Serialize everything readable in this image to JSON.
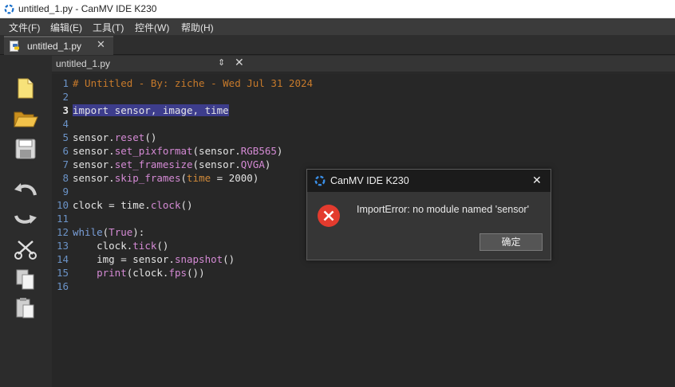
{
  "window": {
    "title": "untitled_1.py - CanMV IDE K230"
  },
  "menubar": {
    "items": [
      {
        "label": "文件(F)"
      },
      {
        "label": "编辑(E)"
      },
      {
        "label": "工具(T)"
      },
      {
        "label": "控件(W)"
      },
      {
        "label": "帮助(H)"
      }
    ]
  },
  "tabs": [
    {
      "label": "untitled_1.py",
      "close_glyph": "✕"
    }
  ],
  "editor": {
    "document_name": "untitled_1.py",
    "switch_glyph": "⇕",
    "close_glyph": "✕",
    "current_line": 3,
    "lines": [
      {
        "num": "1",
        "segs": [
          {
            "t": "# Untitled - By: ziche - Wed Jul 31 2024",
            "c": "#c77a2b"
          }
        ]
      },
      {
        "num": "2",
        "segs": []
      },
      {
        "num": "3",
        "segs": [
          {
            "t": "import sensor, image, time",
            "c": "#e4e4e4",
            "sel": true
          }
        ]
      },
      {
        "num": "4",
        "segs": []
      },
      {
        "num": "5",
        "segs": [
          {
            "t": "sensor.",
            "c": "#e4e4e4"
          },
          {
            "t": "reset",
            "c": "#d48ad4"
          },
          {
            "t": "()",
            "c": "#e4e4e4"
          }
        ]
      },
      {
        "num": "6",
        "segs": [
          {
            "t": "sensor.",
            "c": "#e4e4e4"
          },
          {
            "t": "set_pixformat",
            "c": "#d48ad4"
          },
          {
            "t": "(sensor.",
            "c": "#e4e4e4"
          },
          {
            "t": "RGB565",
            "c": "#d48ad4"
          },
          {
            "t": ")",
            "c": "#e4e4e4"
          }
        ]
      },
      {
        "num": "7",
        "segs": [
          {
            "t": "sensor.",
            "c": "#e4e4e4"
          },
          {
            "t": "set_framesize",
            "c": "#d48ad4"
          },
          {
            "t": "(sensor.",
            "c": "#e4e4e4"
          },
          {
            "t": "QVGA",
            "c": "#d48ad4"
          },
          {
            "t": ")",
            "c": "#e4e4e4"
          }
        ]
      },
      {
        "num": "8",
        "segs": [
          {
            "t": "sensor.",
            "c": "#e4e4e4"
          },
          {
            "t": "skip_frames",
            "c": "#d48ad4"
          },
          {
            "t": "(",
            "c": "#e4e4e4"
          },
          {
            "t": "time",
            "c": "#d08a3a"
          },
          {
            "t": " = ",
            "c": "#e4e4e4"
          },
          {
            "t": "2000",
            "c": "#e4e4e4"
          },
          {
            "t": ")",
            "c": "#e4e4e4"
          }
        ]
      },
      {
        "num": "9",
        "segs": []
      },
      {
        "num": "10",
        "segs": [
          {
            "t": "clock = time.",
            "c": "#e4e4e4"
          },
          {
            "t": "clock",
            "c": "#d48ad4"
          },
          {
            "t": "()",
            "c": "#e4e4e4"
          }
        ]
      },
      {
        "num": "11",
        "segs": []
      },
      {
        "num": "12",
        "segs": [
          {
            "t": "while",
            "c": "#7a9fd9"
          },
          {
            "t": "(",
            "c": "#e4e4e4"
          },
          {
            "t": "True",
            "c": "#d48ad4"
          },
          {
            "t": "):",
            "c": "#e4e4e4"
          }
        ]
      },
      {
        "num": "13",
        "segs": [
          {
            "t": "    clock.",
            "c": "#e4e4e4"
          },
          {
            "t": "tick",
            "c": "#d48ad4"
          },
          {
            "t": "()",
            "c": "#e4e4e4"
          }
        ]
      },
      {
        "num": "14",
        "segs": [
          {
            "t": "    img = sensor.",
            "c": "#e4e4e4"
          },
          {
            "t": "snapshot",
            "c": "#d48ad4"
          },
          {
            "t": "()",
            "c": "#e4e4e4"
          }
        ]
      },
      {
        "num": "15",
        "segs": [
          {
            "t": "    ",
            "c": "#e4e4e4"
          },
          {
            "t": "print",
            "c": "#d48ad4"
          },
          {
            "t": "(clock.",
            "c": "#e4e4e4"
          },
          {
            "t": "fps",
            "c": "#d48ad4"
          },
          {
            "t": "())",
            "c": "#e4e4e4"
          }
        ]
      },
      {
        "num": "16",
        "segs": []
      }
    ]
  },
  "toolbar": {
    "tools": [
      {
        "icon": "new-file-icon"
      },
      {
        "icon": "open-folder-icon"
      },
      {
        "icon": "save-icon"
      },
      {
        "icon": "undo-icon"
      },
      {
        "icon": "redo-icon"
      },
      {
        "icon": "cut-icon"
      },
      {
        "icon": "copy-icon"
      },
      {
        "icon": "paste-icon"
      }
    ]
  },
  "dialog": {
    "title": "CanMV IDE K230",
    "close_glyph": "✕",
    "message": "ImportError: no module named 'sensor'",
    "ok_label": "确定",
    "icon": "error-icon"
  },
  "colors": {
    "selection": "#3d3d8c",
    "comment": "#c77a2b",
    "function": "#d48ad4",
    "keyword": "#7a9fd9",
    "line_number": "#6b93c7",
    "error_red": "#e33b2e"
  }
}
